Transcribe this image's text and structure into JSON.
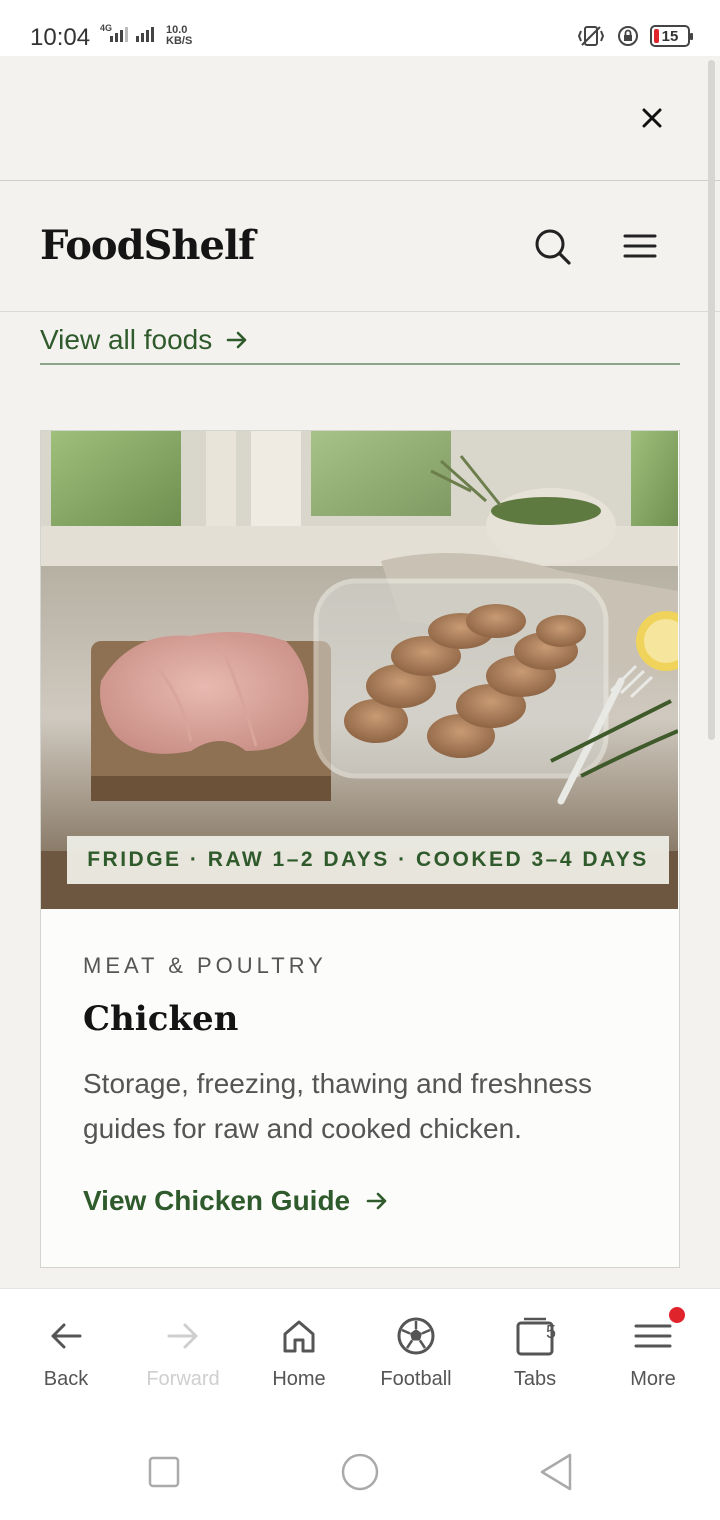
{
  "status_bar": {
    "time": "10:04",
    "network": "4G",
    "speed_value": "10.0",
    "speed_unit": "KB/S",
    "battery": "15",
    "battery_color": "#e0242b"
  },
  "browser": {
    "close_icon": "close-icon"
  },
  "site": {
    "logo": "FoodShelf",
    "search_icon": "search-icon",
    "menu_icon": "hamburger-menu-icon",
    "view_all_label": "View all foods",
    "accent_color": "#2f5a2b"
  },
  "card": {
    "storage_strip": "FRIDGE · RAW 1–2 DAYS · COOKED 3–4 DAYS",
    "category": "MEAT & POULTRY",
    "title": "Chicken",
    "description": "Storage, freezing, thawing and freshness guides for raw and cooked chicken.",
    "link_label": "View Chicken Guide"
  },
  "bottom_nav": {
    "items": [
      {
        "label": "Back",
        "icon": "back-arrow-icon"
      },
      {
        "label": "Forward",
        "icon": "forward-arrow-icon"
      },
      {
        "label": "Home",
        "icon": "home-icon"
      },
      {
        "label": "Football",
        "icon": "football-icon"
      },
      {
        "label": "Tabs",
        "icon": "tabs-icon"
      },
      {
        "label": "More",
        "icon": "more-menu-icon"
      }
    ],
    "tabs_count": "5",
    "notification_color": "#e0242b"
  },
  "system_nav": {
    "icons": [
      "recents-square-icon",
      "home-circle-icon",
      "back-triangle-icon"
    ]
  }
}
